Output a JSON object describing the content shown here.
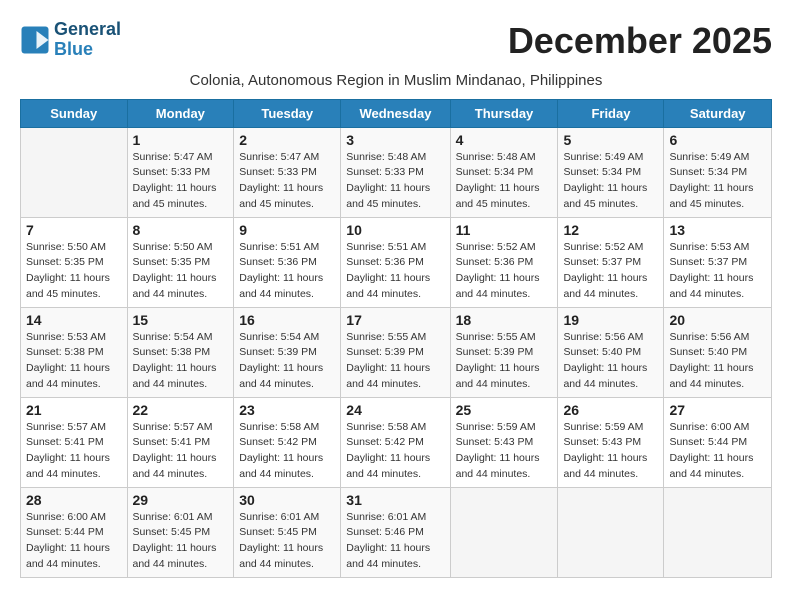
{
  "header": {
    "logo_line1": "General",
    "logo_line2": "Blue",
    "month_title": "December 2025",
    "location": "Colonia, Autonomous Region in Muslim Mindanao, Philippines"
  },
  "weekdays": [
    "Sunday",
    "Monday",
    "Tuesday",
    "Wednesday",
    "Thursday",
    "Friday",
    "Saturday"
  ],
  "weeks": [
    [
      {
        "day": "",
        "info": ""
      },
      {
        "day": "1",
        "info": "Sunrise: 5:47 AM\nSunset: 5:33 PM\nDaylight: 11 hours\nand 45 minutes."
      },
      {
        "day": "2",
        "info": "Sunrise: 5:47 AM\nSunset: 5:33 PM\nDaylight: 11 hours\nand 45 minutes."
      },
      {
        "day": "3",
        "info": "Sunrise: 5:48 AM\nSunset: 5:33 PM\nDaylight: 11 hours\nand 45 minutes."
      },
      {
        "day": "4",
        "info": "Sunrise: 5:48 AM\nSunset: 5:34 PM\nDaylight: 11 hours\nand 45 minutes."
      },
      {
        "day": "5",
        "info": "Sunrise: 5:49 AM\nSunset: 5:34 PM\nDaylight: 11 hours\nand 45 minutes."
      },
      {
        "day": "6",
        "info": "Sunrise: 5:49 AM\nSunset: 5:34 PM\nDaylight: 11 hours\nand 45 minutes."
      }
    ],
    [
      {
        "day": "7",
        "info": "Sunrise: 5:50 AM\nSunset: 5:35 PM\nDaylight: 11 hours\nand 45 minutes."
      },
      {
        "day": "8",
        "info": "Sunrise: 5:50 AM\nSunset: 5:35 PM\nDaylight: 11 hours\nand 44 minutes."
      },
      {
        "day": "9",
        "info": "Sunrise: 5:51 AM\nSunset: 5:36 PM\nDaylight: 11 hours\nand 44 minutes."
      },
      {
        "day": "10",
        "info": "Sunrise: 5:51 AM\nSunset: 5:36 PM\nDaylight: 11 hours\nand 44 minutes."
      },
      {
        "day": "11",
        "info": "Sunrise: 5:52 AM\nSunset: 5:36 PM\nDaylight: 11 hours\nand 44 minutes."
      },
      {
        "day": "12",
        "info": "Sunrise: 5:52 AM\nSunset: 5:37 PM\nDaylight: 11 hours\nand 44 minutes."
      },
      {
        "day": "13",
        "info": "Sunrise: 5:53 AM\nSunset: 5:37 PM\nDaylight: 11 hours\nand 44 minutes."
      }
    ],
    [
      {
        "day": "14",
        "info": "Sunrise: 5:53 AM\nSunset: 5:38 PM\nDaylight: 11 hours\nand 44 minutes."
      },
      {
        "day": "15",
        "info": "Sunrise: 5:54 AM\nSunset: 5:38 PM\nDaylight: 11 hours\nand 44 minutes."
      },
      {
        "day": "16",
        "info": "Sunrise: 5:54 AM\nSunset: 5:39 PM\nDaylight: 11 hours\nand 44 minutes."
      },
      {
        "day": "17",
        "info": "Sunrise: 5:55 AM\nSunset: 5:39 PM\nDaylight: 11 hours\nand 44 minutes."
      },
      {
        "day": "18",
        "info": "Sunrise: 5:55 AM\nSunset: 5:39 PM\nDaylight: 11 hours\nand 44 minutes."
      },
      {
        "day": "19",
        "info": "Sunrise: 5:56 AM\nSunset: 5:40 PM\nDaylight: 11 hours\nand 44 minutes."
      },
      {
        "day": "20",
        "info": "Sunrise: 5:56 AM\nSunset: 5:40 PM\nDaylight: 11 hours\nand 44 minutes."
      }
    ],
    [
      {
        "day": "21",
        "info": "Sunrise: 5:57 AM\nSunset: 5:41 PM\nDaylight: 11 hours\nand 44 minutes."
      },
      {
        "day": "22",
        "info": "Sunrise: 5:57 AM\nSunset: 5:41 PM\nDaylight: 11 hours\nand 44 minutes."
      },
      {
        "day": "23",
        "info": "Sunrise: 5:58 AM\nSunset: 5:42 PM\nDaylight: 11 hours\nand 44 minutes."
      },
      {
        "day": "24",
        "info": "Sunrise: 5:58 AM\nSunset: 5:42 PM\nDaylight: 11 hours\nand 44 minutes."
      },
      {
        "day": "25",
        "info": "Sunrise: 5:59 AM\nSunset: 5:43 PM\nDaylight: 11 hours\nand 44 minutes."
      },
      {
        "day": "26",
        "info": "Sunrise: 5:59 AM\nSunset: 5:43 PM\nDaylight: 11 hours\nand 44 minutes."
      },
      {
        "day": "27",
        "info": "Sunrise: 6:00 AM\nSunset: 5:44 PM\nDaylight: 11 hours\nand 44 minutes."
      }
    ],
    [
      {
        "day": "28",
        "info": "Sunrise: 6:00 AM\nSunset: 5:44 PM\nDaylight: 11 hours\nand 44 minutes."
      },
      {
        "day": "29",
        "info": "Sunrise: 6:01 AM\nSunset: 5:45 PM\nDaylight: 11 hours\nand 44 minutes."
      },
      {
        "day": "30",
        "info": "Sunrise: 6:01 AM\nSunset: 5:45 PM\nDaylight: 11 hours\nand 44 minutes."
      },
      {
        "day": "31",
        "info": "Sunrise: 6:01 AM\nSunset: 5:46 PM\nDaylight: 11 hours\nand 44 minutes."
      },
      {
        "day": "",
        "info": ""
      },
      {
        "day": "",
        "info": ""
      },
      {
        "day": "",
        "info": ""
      }
    ]
  ]
}
